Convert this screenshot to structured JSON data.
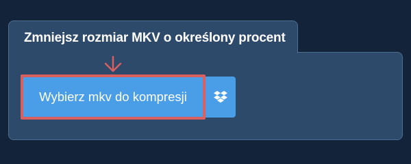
{
  "panel": {
    "title": "Zmniejsz rozmiar MKV o określony procent"
  },
  "upload": {
    "button_label": "Wybierz mkv do kompresji",
    "dropbox_icon": "dropbox-icon"
  },
  "annotation": {
    "arrow_icon": "arrow-down-icon",
    "color": "#d9605e"
  },
  "colors": {
    "background": "#13243a",
    "panel": "#2d4a6b",
    "button": "#4a9ee8",
    "highlight": "#d9605e"
  }
}
